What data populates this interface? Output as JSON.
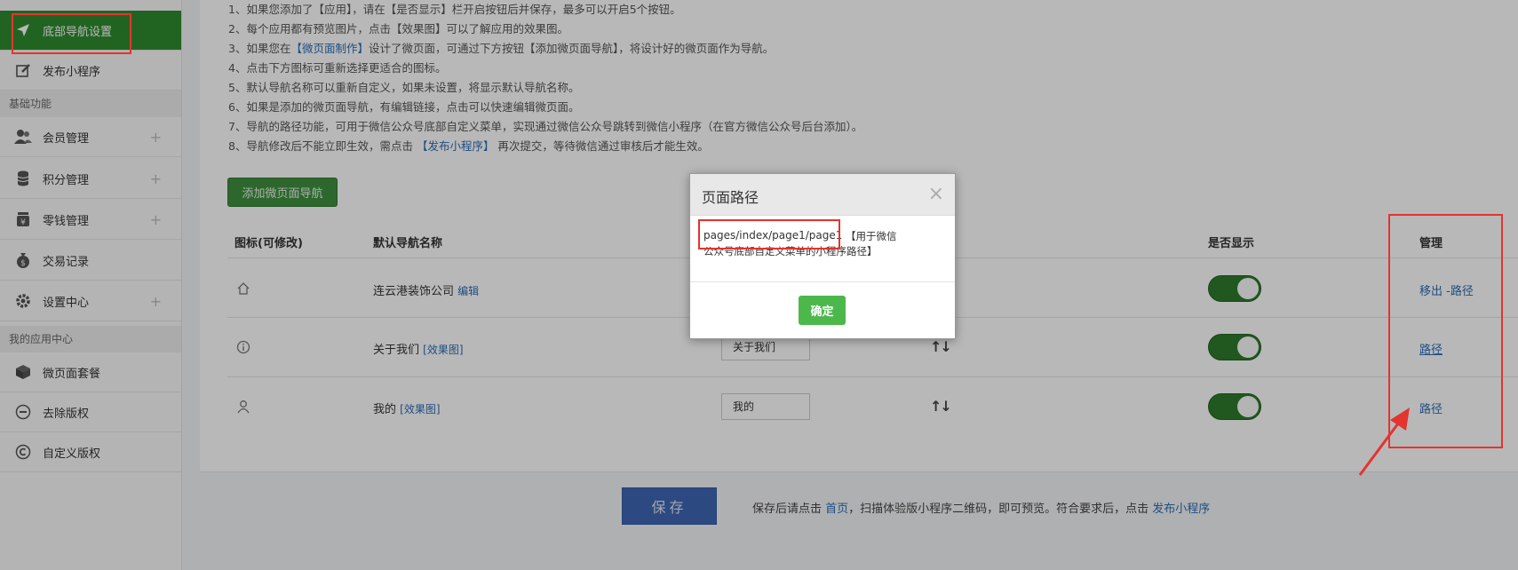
{
  "sidebar": {
    "active_item": "底部导航设置",
    "item_publish": "发布小程序",
    "section_basic": "基础功能",
    "basic_items": [
      "会员管理",
      "积分管理",
      "零钱管理",
      "交易记录",
      "设置中心"
    ],
    "section_apps": "我的应用中心",
    "app_items": [
      "微页面套餐",
      "去除版权",
      "自定义版权"
    ]
  },
  "tips": [
    "1、如果您添加了【应用】，请在【是否显示】栏开启按钮后并保存，最多可以开启5个按钮。",
    "2、每个应用都有预览图片，点击【效果图】可以了解应用的效果图。",
    "3、如果您在【微页面制作】设计了微页面，可通过下方按钮【添加微页面导航】，将设计好的微页面作为导航。",
    "4、点击下方图标可重新选择更适合的图标。",
    "5、默认导航名称可以重新自定义，如果未设置，将显示默认导航名称。",
    "6、如果是添加的微页面导航，有编辑链接，点击可以快速编辑微页面。",
    "7、导航的路径功能，可用于微信公众号底部自定义菜单，实现通过微信公众号跳转到微信小程序（在官方微信公众号后台添加）。",
    "8、导航修改后不能立即生效，需点击 【发布小程序】 再次提交，等待微信通过审核后才能生效。"
  ],
  "tips_links": {
    "tip3_pre": "3、如果您在",
    "tip3_link": "【微页面制作】",
    "tip3_post": "设计了微页面，可通过下方按钮【添加微页面导航】，将设计好的微页面作为导航。",
    "tip8_pre": "8、导航修改后不能立即生效，需点击 ",
    "tip8_link": "【发布小程序】",
    "tip8_post": " 再次提交，等待微信通过审核后才能生效。"
  },
  "add_button": "添加微页面导航",
  "table": {
    "headers": [
      "图标(可修改)",
      "默认导航名称",
      "是否显示",
      "管理"
    ],
    "rows": [
      {
        "name": "连云港装饰公司",
        "link": "编辑",
        "nav_name": "",
        "manage": "移出 -路径"
      },
      {
        "name": "关于我们",
        "link": "[效果图]",
        "nav_name": "关于我们",
        "manage": "路径"
      },
      {
        "name": "我的",
        "link": "[效果图]",
        "nav_name": "我的",
        "manage": "路径"
      }
    ],
    "arrows": "↑↓"
  },
  "footer": {
    "save": "保存",
    "text_pre": "保存后请点击 ",
    "link1": "首页",
    "text_mid": "，扫描体验版小程序二维码，即可预览。符合要求后，点击 ",
    "link2": "发布小程序"
  },
  "modal": {
    "title": "页面路径",
    "close": "×",
    "path": "pages/index/page1/page1",
    "note_line1": "【用于微信",
    "note_line2": "公众号底部自定义菜单的小程序路径】",
    "ok": "确定"
  },
  "colors": {
    "active_green": "#2e8b2e",
    "link_blue": "#2d6cb5",
    "highlight_red": "#e3342f",
    "save_blue": "#3f66b3",
    "ok_green": "#4cb84c"
  }
}
